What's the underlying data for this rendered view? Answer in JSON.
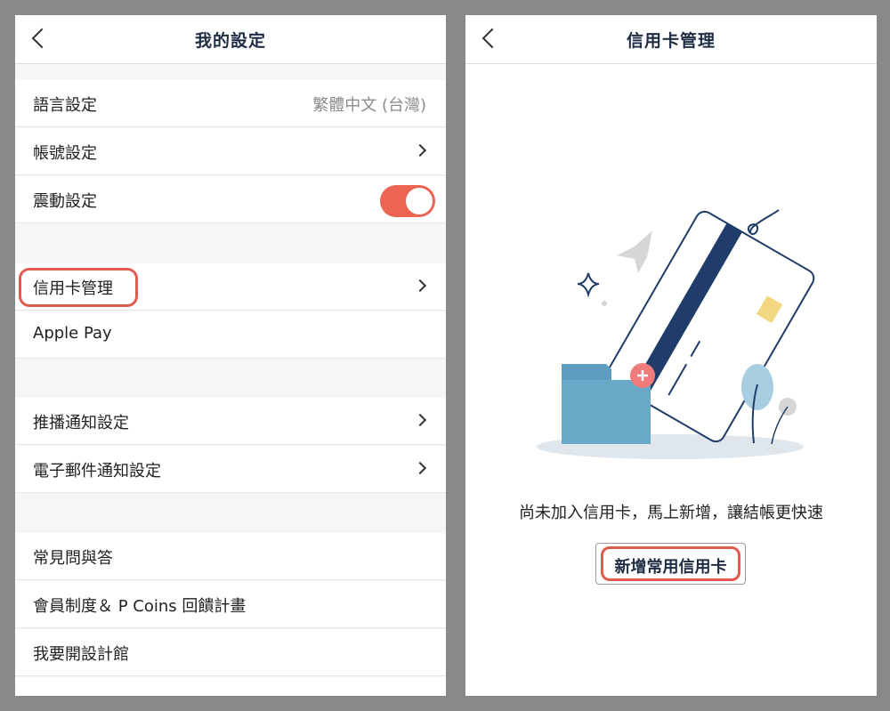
{
  "left_screen": {
    "title": "我的設定",
    "groups": [
      [
        {
          "label": "語言設定",
          "value": "繁體中文 (台灣)",
          "accessory": "value"
        },
        {
          "label": "帳號設定",
          "accessory": "chevron"
        },
        {
          "label": "震動設定",
          "accessory": "toggle",
          "toggle_on": true
        }
      ],
      [
        {
          "label": "信用卡管理",
          "accessory": "chevron",
          "highlighted": true
        },
        {
          "label": "Apple Pay",
          "accessory": "none"
        }
      ],
      [
        {
          "label": "推播通知設定",
          "accessory": "chevron"
        },
        {
          "label": "電子郵件通知設定",
          "accessory": "chevron"
        }
      ],
      [
        {
          "label": "常見問與答",
          "accessory": "none"
        },
        {
          "label": "會員制度＆ P Coins 回饋計畫",
          "accessory": "none"
        },
        {
          "label": "我要開設計館",
          "accessory": "none"
        }
      ]
    ]
  },
  "right_screen": {
    "title": "信用卡管理",
    "empty_message": "尚未加入信用卡，馬上新增，讓結帳更快速",
    "add_button_label": "新增常用信用卡"
  },
  "colors": {
    "highlight": "#e05a4e",
    "toggle_on": "#ec6452",
    "card_stripe": "#1f3c6a",
    "folder": "#6aa8c8"
  }
}
